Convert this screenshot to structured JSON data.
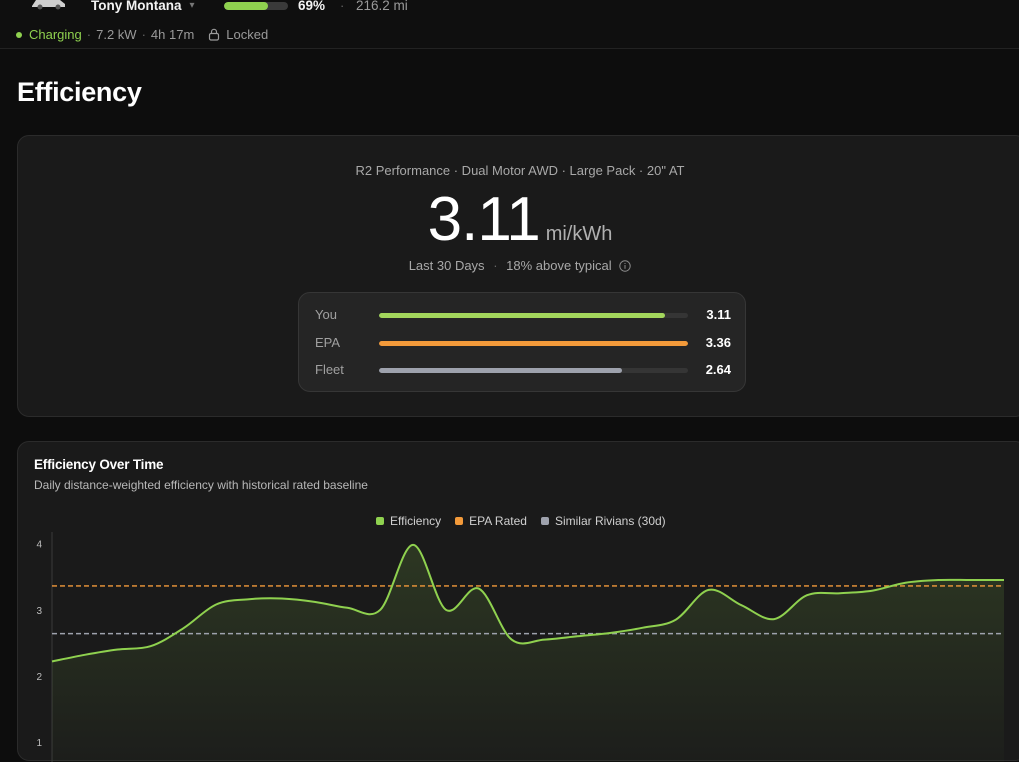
{
  "header": {
    "owner_name": "Tony Montana",
    "battery_percent": 69,
    "battery_label": "69%",
    "range": "216.2 mi",
    "separator": "·",
    "status": "Charging",
    "charge_rate": "7.2 kW",
    "time_remaining": "4h 17m",
    "lock_status": "Locked",
    "accent_color": "#8fd14f"
  },
  "page": {
    "title": "Efficiency"
  },
  "summary": {
    "model": "R2 Performance · Dual Motor AWD · Large Pack · 20\" AT",
    "value": "3.11",
    "unit": "mi/kWh",
    "period": "Last 30 Days",
    "delta": "18% above typical",
    "comparison": [
      {
        "label": "You",
        "value": "3.11",
        "fraction": 0.925,
        "color": "#a3d65c"
      },
      {
        "label": "EPA",
        "value": "3.36",
        "fraction": 1.0,
        "color": "#f39a3a"
      },
      {
        "label": "Fleet",
        "value": "2.64",
        "fraction": 0.785,
        "color": "#9ea2ad"
      }
    ]
  },
  "chart": {
    "title": "Efficiency Over Time",
    "subtitle": "Daily distance-weighted efficiency with historical rated baseline",
    "legend": [
      {
        "label": "Efficiency",
        "color": "#8fd14f"
      },
      {
        "label": "EPA Rated",
        "color": "#f39a3a"
      },
      {
        "label": "Similar Rivians (30d)",
        "color": "#9ea2ad"
      }
    ]
  },
  "chart_data": {
    "type": "line",
    "title": "Efficiency Over Time",
    "yticks": [
      1,
      2,
      3,
      4
    ],
    "ylim": [
      0.7,
      4.1
    ],
    "x_count": 30,
    "series": [
      {
        "name": "Efficiency",
        "color": "#8fd14f",
        "values": [
          2.22,
          2.32,
          2.4,
          2.45,
          2.72,
          3.08,
          3.16,
          3.17,
          3.12,
          3.03,
          3.0,
          3.98,
          3.0,
          3.32,
          2.55,
          2.55,
          2.6,
          2.65,
          2.73,
          2.85,
          3.3,
          3.07,
          2.86,
          3.22,
          3.25,
          3.29,
          3.41,
          3.45,
          3.45,
          3.45
        ]
      }
    ],
    "reference_lines": [
      {
        "name": "EPA Rated",
        "value": 3.36,
        "color": "#f39a3a"
      },
      {
        "name": "Similar Rivians (30d)",
        "value": 2.64,
        "color": "#9ea2ad"
      }
    ],
    "grid": false
  }
}
